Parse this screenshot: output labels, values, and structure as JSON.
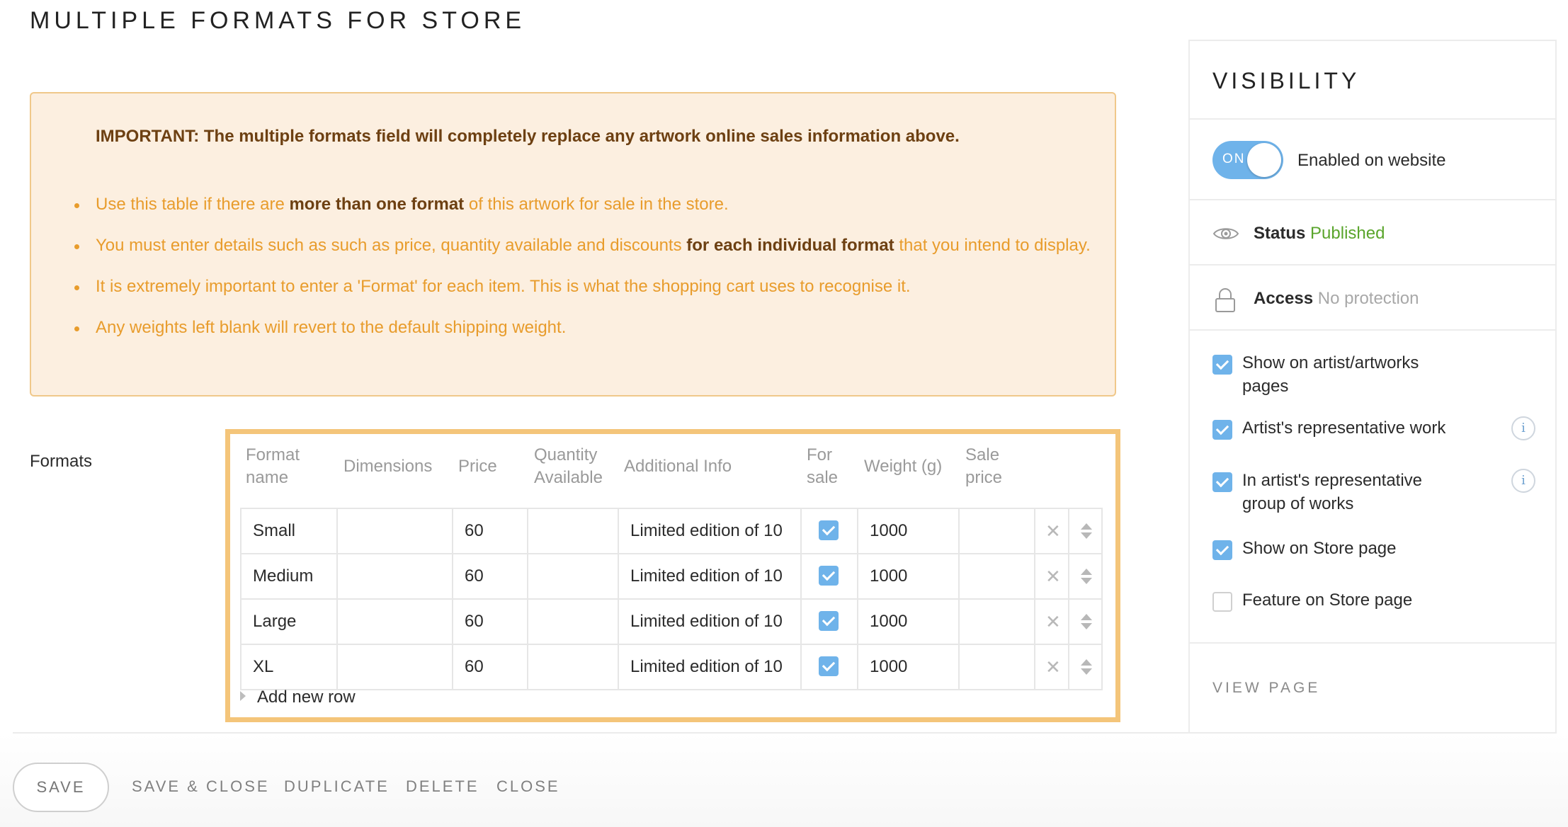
{
  "page": {
    "title": "MULTIPLE FORMATS FOR STORE"
  },
  "notice": {
    "important": "IMPORTANT: The multiple formats field will completely replace any artwork online sales information above.",
    "bullets": [
      {
        "pre": "Use this table if there are ",
        "bold": "more than one format",
        "post": " of this artwork for sale in the store."
      },
      {
        "pre": "You must enter details such as such as price, quantity available and discounts ",
        "bold": "for each individual format",
        "post": " that you intend to display."
      },
      {
        "pre": "It is extremely important to enter a 'Format' for each item. This is what the shopping cart uses to recognise it.",
        "bold": "",
        "post": ""
      },
      {
        "pre": "Any weights left blank will revert to the default shipping weight.",
        "bold": "",
        "post": ""
      }
    ]
  },
  "formats": {
    "label": "Formats",
    "columns": {
      "format_name": [
        "Format",
        "name"
      ],
      "dimensions": "Dimensions",
      "price": "Price",
      "quantity": [
        "Quantity",
        "Available"
      ],
      "additional_info": "Additional Info",
      "for_sale": [
        "For",
        "sale"
      ],
      "weight": "Weight (g)",
      "sale_price": [
        "Sale",
        "price"
      ]
    },
    "rows": [
      {
        "name": "Small",
        "dimensions": "",
        "price": "60",
        "quantity": "",
        "info": "Limited edition of 10",
        "for_sale": true,
        "weight": "1000",
        "sale_price": ""
      },
      {
        "name": "Medium",
        "dimensions": "",
        "price": "60",
        "quantity": "",
        "info": "Limited edition of 10",
        "for_sale": true,
        "weight": "1000",
        "sale_price": ""
      },
      {
        "name": "Large",
        "dimensions": "",
        "price": "60",
        "quantity": "",
        "info": "Limited edition of 10",
        "for_sale": true,
        "weight": "1000",
        "sale_price": ""
      },
      {
        "name": "XL",
        "dimensions": "",
        "price": "60",
        "quantity": "",
        "info": "Limited edition of 10",
        "for_sale": true,
        "weight": "1000",
        "sale_price": ""
      }
    ],
    "add_row": "Add new row"
  },
  "actions": {
    "save": "SAVE",
    "save_close": "SAVE & CLOSE",
    "duplicate": "DUPLICATE",
    "delete": "DELETE",
    "close": "CLOSE"
  },
  "sidebar": {
    "title": "VISIBILITY",
    "toggle": {
      "state": "ON",
      "label": "Enabled on website",
      "enabled": true
    },
    "status": {
      "label": "Status",
      "value": "Published"
    },
    "access": {
      "label": "Access",
      "value": "No protection"
    },
    "options": [
      {
        "label": "Show on artist/artworks pages",
        "checked": true,
        "info": false
      },
      {
        "label": "Artist's representative work",
        "checked": true,
        "info": true
      },
      {
        "label": "In artist's representative group of works",
        "checked": true,
        "info": true
      },
      {
        "label": "Show on Store page",
        "checked": true,
        "info": false
      },
      {
        "label": "Feature on Store page",
        "checked": false,
        "info": false
      }
    ],
    "view_page": "VIEW PAGE",
    "info_glyph": "i"
  },
  "colors": {
    "accent_blue": "#6fb3ea",
    "notice_bg": "#fcefe0",
    "notice_border": "#f0c88a",
    "notice_text": "#e89c2c",
    "notice_bold": "#6d4012",
    "table_highlight": "#f4c57a",
    "published_green": "#5aa52c"
  },
  "icons": {
    "eye": "eye-icon",
    "lock": "lock-icon",
    "delete_row": "close-icon",
    "reorder": "drag-handle-icon",
    "info": "info-icon",
    "expand": "caret-right-icon"
  }
}
